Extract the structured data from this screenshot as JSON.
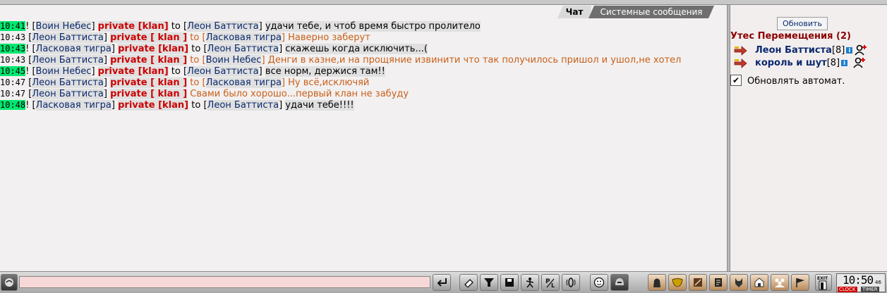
{
  "tabs": {
    "chat": "Чат",
    "system": "Системные сообщения"
  },
  "chat": [
    {
      "time": "10:41",
      "hl": true,
      "pre": "! [",
      "name": "Воин Небес",
      "privacy": "private [klan]",
      "to": "to",
      "target": "Леон Баттиста",
      "msg": "удачи тебе, и чтоб время быстро пролитело",
      "sent": false
    },
    {
      "time": "10:43",
      "hl": false,
      "pre": " [",
      "name": "Леон Баттиста",
      "privacy": "private [ klan ]",
      "to": "to",
      "target": "Ласковая тигра",
      "msg": "Наверно заберут",
      "sent": true
    },
    {
      "time": "10:43",
      "hl": true,
      "pre": "! [",
      "name": "Ласковая тигра",
      "privacy": "private [klan]",
      "to": "to",
      "target": "Леон Баттиста",
      "msg": "скажешь когда исключить...(",
      "sent": false
    },
    {
      "time": "10:43",
      "hl": false,
      "pre": " [",
      "name": "Леон Баттиста",
      "privacy": "private [ klan ]",
      "to": "to",
      "target": "Воин Небес",
      "msg": "Денги в казне,и на прощяние извинити что так получилось пришол и ушол,не хотел",
      "sent": true
    },
    {
      "time": "10:45",
      "hl": true,
      "pre": "! [",
      "name": "Воин Небес",
      "privacy": "private [klan]",
      "to": "to",
      "target": "Леон Баттиста",
      "msg": "все норм, держися там!!",
      "sent": false
    },
    {
      "time": "10:47",
      "hl": false,
      "pre": " [",
      "name": "Леон Баттиста",
      "privacy": "private [ klan ]",
      "to": "to",
      "target": "Ласковая тигра",
      "msg": "Ну всё,исключяй",
      "sent": true
    },
    {
      "time": "10:47",
      "hl": false,
      "pre": " [",
      "name": "Леон Баттиста",
      "privacy": "private [ klan ]",
      "to": "",
      "target": "",
      "msg": "Свами было хорошо...первый клан не забуду",
      "sent": true
    },
    {
      "time": "10:48",
      "hl": true,
      "pre": "! [",
      "name": "Ласковая тигра",
      "privacy": "private [klan]",
      "to": "to",
      "target": "Леон Баттиста",
      "msg": "удачи тебе!!!!",
      "sent": false
    }
  ],
  "sidebar": {
    "refresh": "Обновить",
    "location": "Утес Перемещения (2)",
    "users": [
      {
        "name": "Леон Баттиста",
        "level": "[8]"
      },
      {
        "name": "король и шут",
        "level": "[8]"
      }
    ],
    "auto_refresh": "Обновлять автомат.",
    "auto_checked": "✔"
  },
  "toolbar": {
    "clock_time": "10:50",
    "clock_seconds": "46",
    "clock_label1": "CLOCK",
    "clock_label2": "TIMER",
    "exit_label": "EXIT"
  },
  "colors": {
    "accent_time": "#00e870",
    "private": "#cc0000",
    "name": "#0b2a6e",
    "sent": "#c8601a"
  }
}
